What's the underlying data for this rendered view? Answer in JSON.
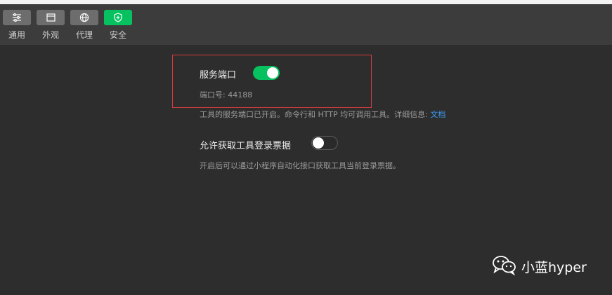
{
  "toolbar": {
    "items": [
      {
        "label": "通用",
        "icon": "sliders-icon"
      },
      {
        "label": "外观",
        "icon": "window-icon"
      },
      {
        "label": "代理",
        "icon": "globe-icon"
      },
      {
        "label": "安全",
        "icon": "shield-icon"
      }
    ],
    "active_index": 3
  },
  "settings": {
    "service_port": {
      "title": "服务端口",
      "enabled": true,
      "port_label": "端口号: 44188",
      "description": "工具的服务端口已开启。命令行和 HTTP 均可调用工具。详细信息:",
      "link_text": "文档"
    },
    "login_ticket": {
      "title": "允许获取工具登录票据",
      "enabled": false,
      "description": "开启后可以通过小程序自动化接口获取工具当前登录票据。"
    }
  },
  "watermark": {
    "text": "小蓝hyper",
    "icon": "wechat-icon"
  },
  "colors": {
    "accent": "#07c160",
    "link": "#3d9bf5",
    "highlight_border": "#d33b3b",
    "background": "#2d2d2d",
    "toolbar_bg": "#3c3c3c"
  }
}
